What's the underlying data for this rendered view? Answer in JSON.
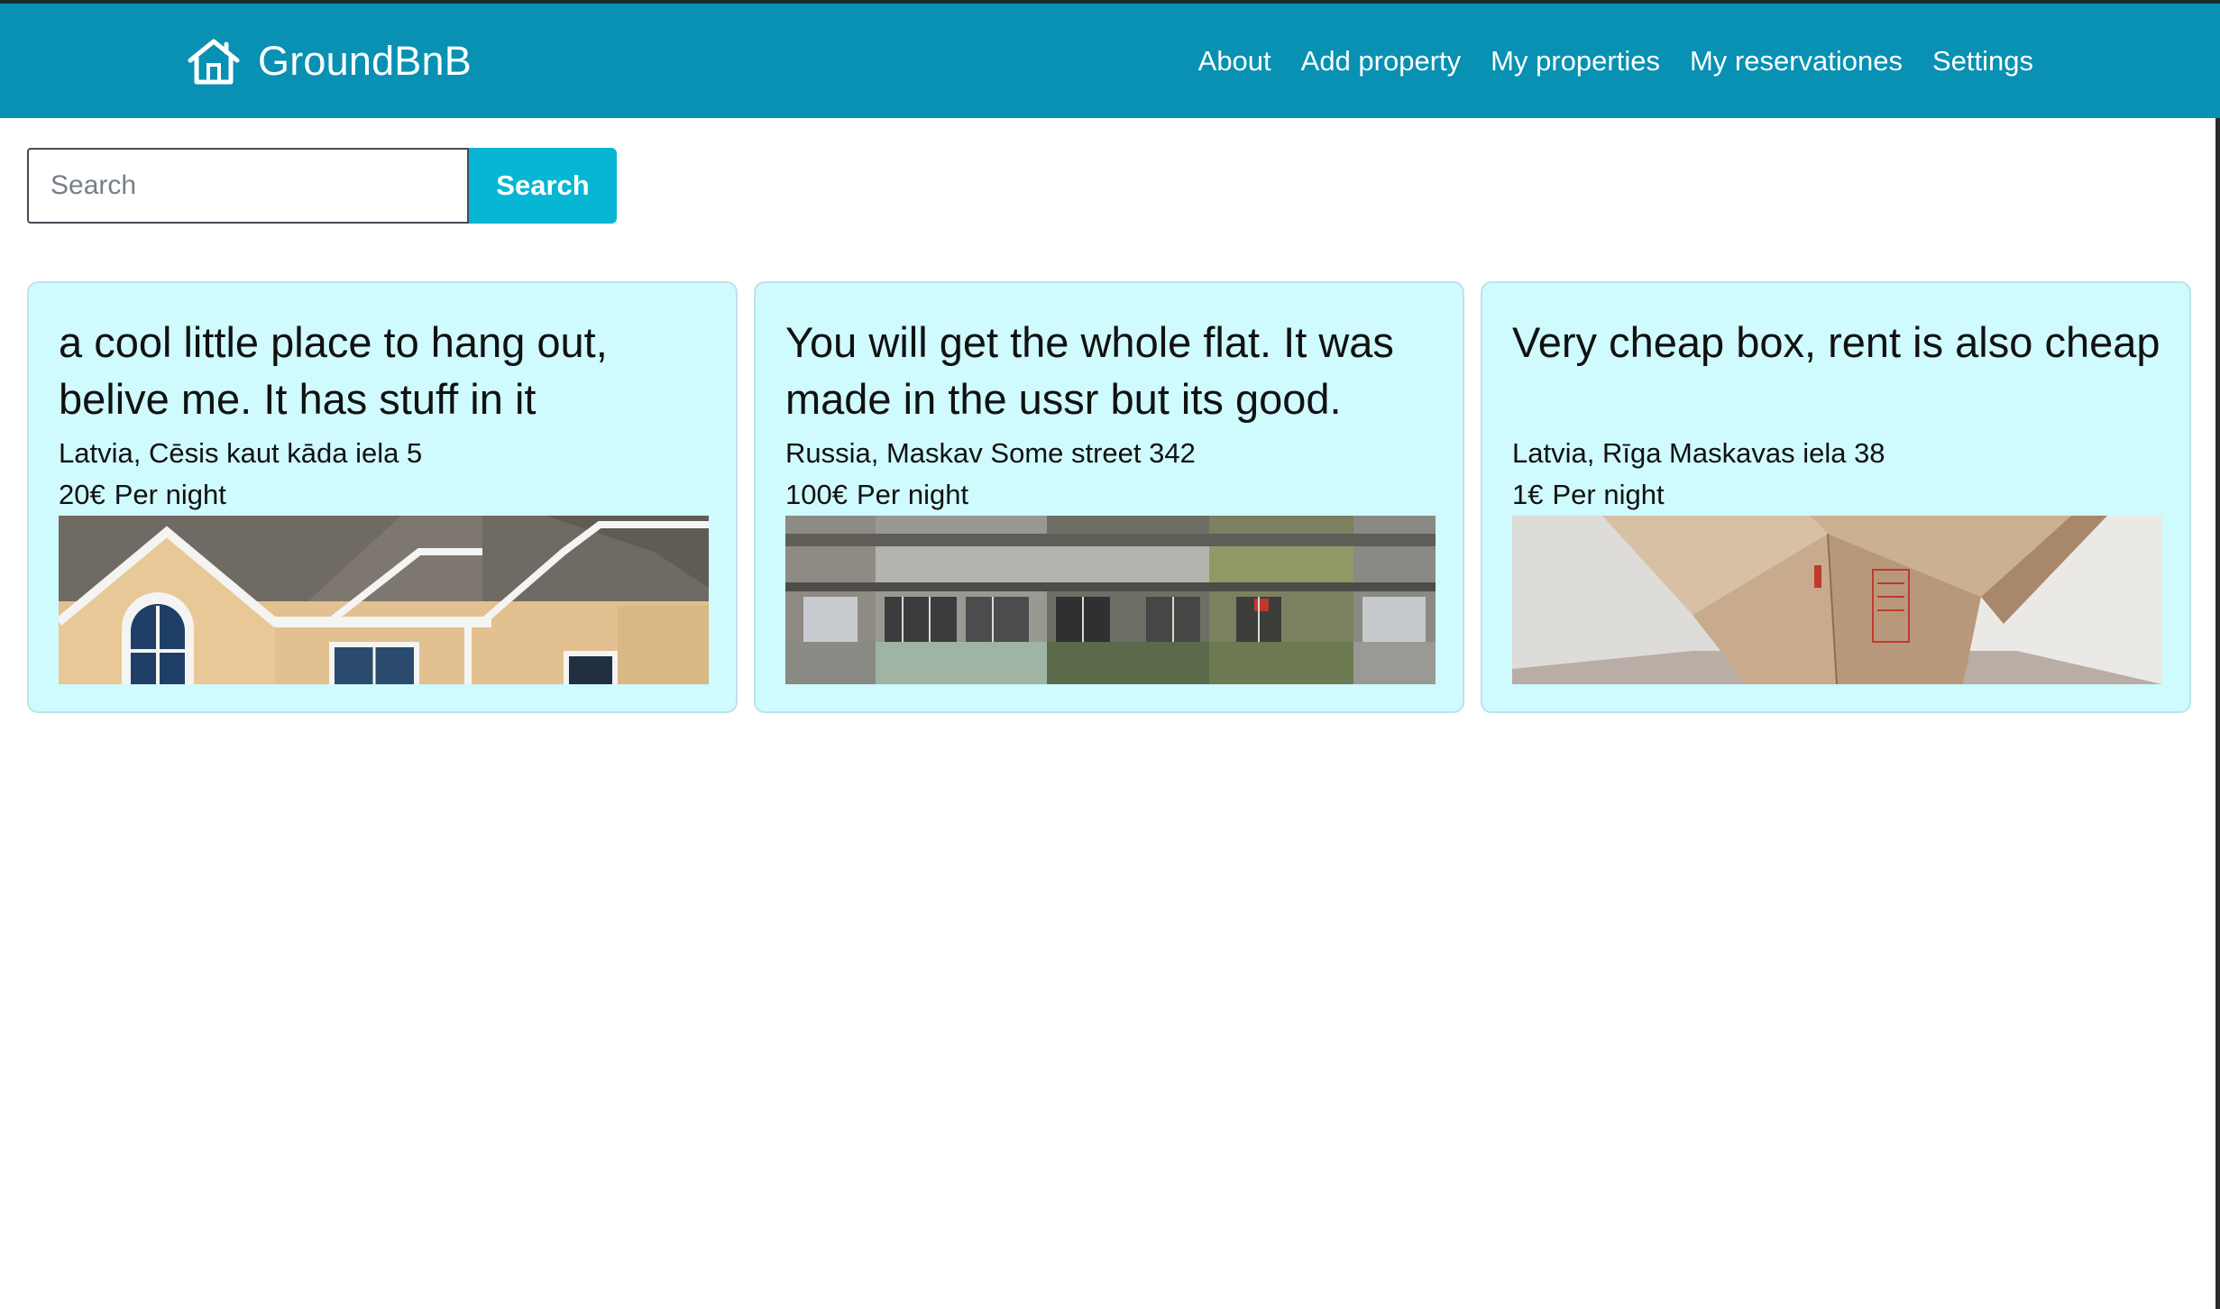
{
  "app": {
    "brand_name": "GroundBnB",
    "brand_icon": "house-icon",
    "brand_color": "#0891b2",
    "accent_color": "#06b6d4",
    "card_color": "#cffafe"
  },
  "nav": {
    "items": [
      {
        "label": "About"
      },
      {
        "label": "Add property"
      },
      {
        "label": "My properties"
      },
      {
        "label": "My reservationes"
      },
      {
        "label": "Settings"
      }
    ]
  },
  "search": {
    "placeholder": "Search",
    "value": "",
    "button_label": "Search"
  },
  "listings": [
    {
      "title": "a cool little place to hang out, belive me. It has stuff in it",
      "address": "Latvia, Cēsis kaut kāda iela 5",
      "price": "20€",
      "price_unit": "Per night",
      "image": "house-photo"
    },
    {
      "title": "You will get the whole flat. It was made in the ussr but its good.",
      "address": "Russia, Maskav Some street 342",
      "price": "100€",
      "price_unit": "Per night",
      "image": "apartment-block-photo"
    },
    {
      "title": "Very cheap box, rent is also cheap",
      "address": "Latvia, Rīga Maskavas iela 38",
      "price": "1€",
      "price_unit": "Per night",
      "image": "cardboard-box-photo"
    }
  ]
}
